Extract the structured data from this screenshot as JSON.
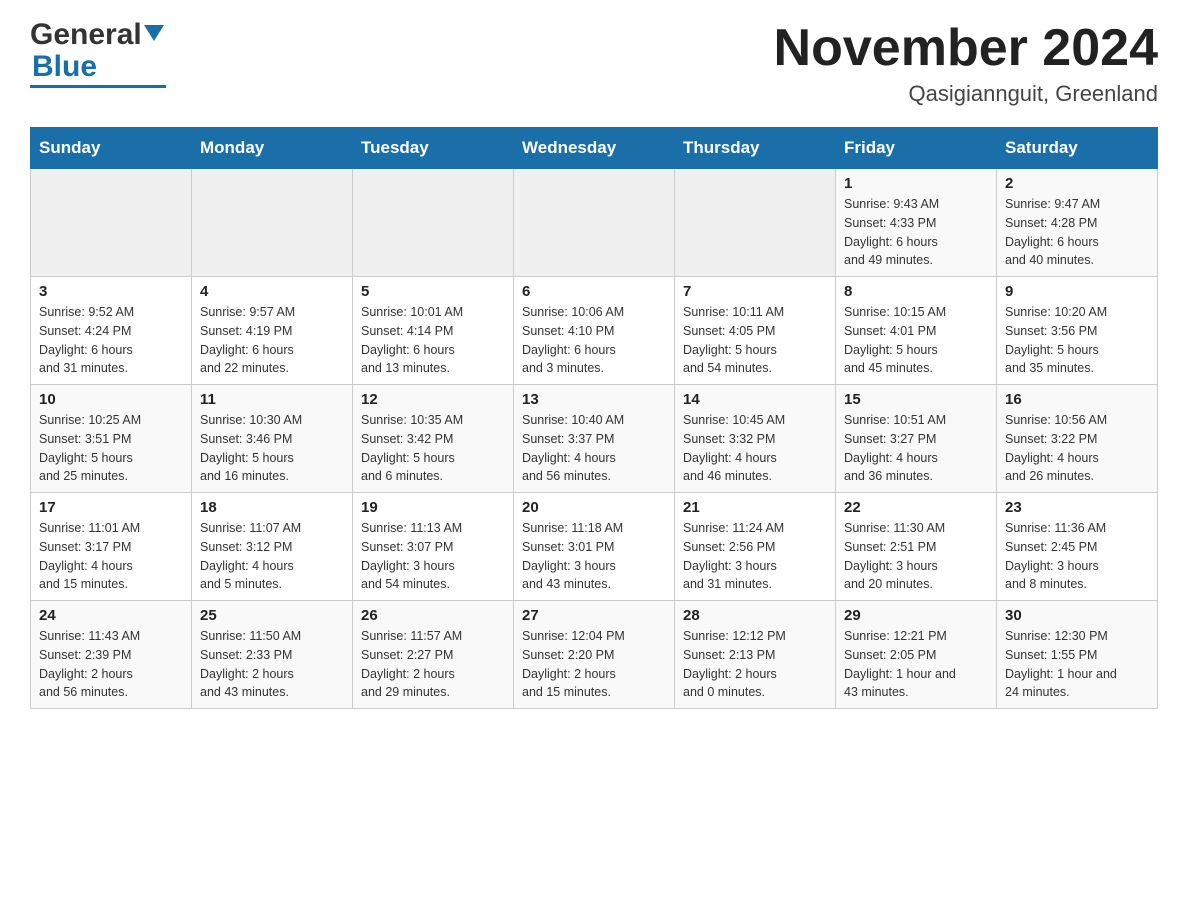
{
  "header": {
    "logo_general": "General",
    "logo_blue": "Blue",
    "month_title": "November 2024",
    "location": "Qasigiannguit, Greenland"
  },
  "weekdays": [
    "Sunday",
    "Monday",
    "Tuesday",
    "Wednesday",
    "Thursday",
    "Friday",
    "Saturday"
  ],
  "weeks": [
    [
      {
        "day": "",
        "info": ""
      },
      {
        "day": "",
        "info": ""
      },
      {
        "day": "",
        "info": ""
      },
      {
        "day": "",
        "info": ""
      },
      {
        "day": "",
        "info": ""
      },
      {
        "day": "1",
        "info": "Sunrise: 9:43 AM\nSunset: 4:33 PM\nDaylight: 6 hours\nand 49 minutes."
      },
      {
        "day": "2",
        "info": "Sunrise: 9:47 AM\nSunset: 4:28 PM\nDaylight: 6 hours\nand 40 minutes."
      }
    ],
    [
      {
        "day": "3",
        "info": "Sunrise: 9:52 AM\nSunset: 4:24 PM\nDaylight: 6 hours\nand 31 minutes."
      },
      {
        "day": "4",
        "info": "Sunrise: 9:57 AM\nSunset: 4:19 PM\nDaylight: 6 hours\nand 22 minutes."
      },
      {
        "day": "5",
        "info": "Sunrise: 10:01 AM\nSunset: 4:14 PM\nDaylight: 6 hours\nand 13 minutes."
      },
      {
        "day": "6",
        "info": "Sunrise: 10:06 AM\nSunset: 4:10 PM\nDaylight: 6 hours\nand 3 minutes."
      },
      {
        "day": "7",
        "info": "Sunrise: 10:11 AM\nSunset: 4:05 PM\nDaylight: 5 hours\nand 54 minutes."
      },
      {
        "day": "8",
        "info": "Sunrise: 10:15 AM\nSunset: 4:01 PM\nDaylight: 5 hours\nand 45 minutes."
      },
      {
        "day": "9",
        "info": "Sunrise: 10:20 AM\nSunset: 3:56 PM\nDaylight: 5 hours\nand 35 minutes."
      }
    ],
    [
      {
        "day": "10",
        "info": "Sunrise: 10:25 AM\nSunset: 3:51 PM\nDaylight: 5 hours\nand 25 minutes."
      },
      {
        "day": "11",
        "info": "Sunrise: 10:30 AM\nSunset: 3:46 PM\nDaylight: 5 hours\nand 16 minutes."
      },
      {
        "day": "12",
        "info": "Sunrise: 10:35 AM\nSunset: 3:42 PM\nDaylight: 5 hours\nand 6 minutes."
      },
      {
        "day": "13",
        "info": "Sunrise: 10:40 AM\nSunset: 3:37 PM\nDaylight: 4 hours\nand 56 minutes."
      },
      {
        "day": "14",
        "info": "Sunrise: 10:45 AM\nSunset: 3:32 PM\nDaylight: 4 hours\nand 46 minutes."
      },
      {
        "day": "15",
        "info": "Sunrise: 10:51 AM\nSunset: 3:27 PM\nDaylight: 4 hours\nand 36 minutes."
      },
      {
        "day": "16",
        "info": "Sunrise: 10:56 AM\nSunset: 3:22 PM\nDaylight: 4 hours\nand 26 minutes."
      }
    ],
    [
      {
        "day": "17",
        "info": "Sunrise: 11:01 AM\nSunset: 3:17 PM\nDaylight: 4 hours\nand 15 minutes."
      },
      {
        "day": "18",
        "info": "Sunrise: 11:07 AM\nSunset: 3:12 PM\nDaylight: 4 hours\nand 5 minutes."
      },
      {
        "day": "19",
        "info": "Sunrise: 11:13 AM\nSunset: 3:07 PM\nDaylight: 3 hours\nand 54 minutes."
      },
      {
        "day": "20",
        "info": "Sunrise: 11:18 AM\nSunset: 3:01 PM\nDaylight: 3 hours\nand 43 minutes."
      },
      {
        "day": "21",
        "info": "Sunrise: 11:24 AM\nSunset: 2:56 PM\nDaylight: 3 hours\nand 31 minutes."
      },
      {
        "day": "22",
        "info": "Sunrise: 11:30 AM\nSunset: 2:51 PM\nDaylight: 3 hours\nand 20 minutes."
      },
      {
        "day": "23",
        "info": "Sunrise: 11:36 AM\nSunset: 2:45 PM\nDaylight: 3 hours\nand 8 minutes."
      }
    ],
    [
      {
        "day": "24",
        "info": "Sunrise: 11:43 AM\nSunset: 2:39 PM\nDaylight: 2 hours\nand 56 minutes."
      },
      {
        "day": "25",
        "info": "Sunrise: 11:50 AM\nSunset: 2:33 PM\nDaylight: 2 hours\nand 43 minutes."
      },
      {
        "day": "26",
        "info": "Sunrise: 11:57 AM\nSunset: 2:27 PM\nDaylight: 2 hours\nand 29 minutes."
      },
      {
        "day": "27",
        "info": "Sunrise: 12:04 PM\nSunset: 2:20 PM\nDaylight: 2 hours\nand 15 minutes."
      },
      {
        "day": "28",
        "info": "Sunrise: 12:12 PM\nSunset: 2:13 PM\nDaylight: 2 hours\nand 0 minutes."
      },
      {
        "day": "29",
        "info": "Sunrise: 12:21 PM\nSunset: 2:05 PM\nDaylight: 1 hour and\n43 minutes."
      },
      {
        "day": "30",
        "info": "Sunrise: 12:30 PM\nSunset: 1:55 PM\nDaylight: 1 hour and\n24 minutes."
      }
    ]
  ]
}
